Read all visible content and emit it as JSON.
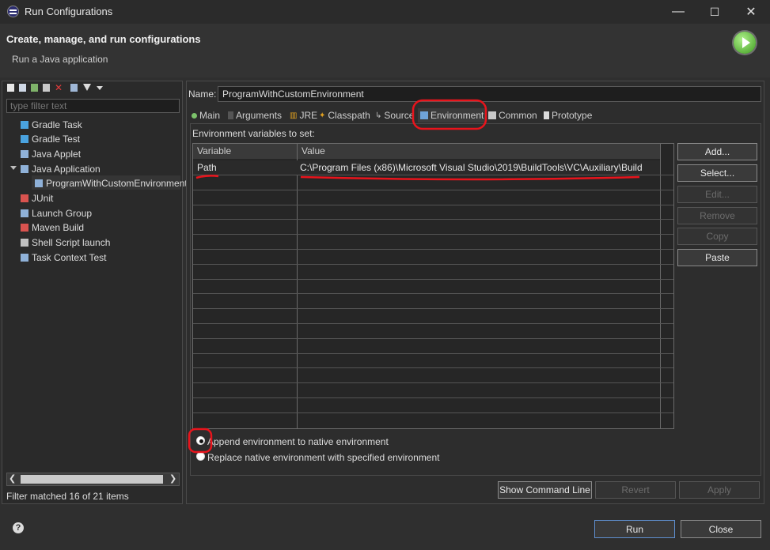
{
  "window": {
    "title": "Run Configurations",
    "minimize": "—",
    "maximize": "☐",
    "close": "✕"
  },
  "header": {
    "title": "Create, manage, and run configurations",
    "subtitle": "Run a Java application"
  },
  "left": {
    "filter_placeholder": "type filter text",
    "tree": [
      {
        "label": "Gradle Task",
        "icon": "gradle-icon",
        "color": "#4aa3df"
      },
      {
        "label": "Gradle Test",
        "icon": "gradle-icon",
        "color": "#4aa3df"
      },
      {
        "label": "Java Applet",
        "icon": "applet-icon",
        "color": "#8fb1d8"
      },
      {
        "label": "Java Application",
        "icon": "java-app-icon",
        "color": "#8fb1d8"
      },
      {
        "label": "ProgramWithCustomEnvironment",
        "icon": "java-app-icon",
        "color": "#8fb1d8"
      },
      {
        "label": "JUnit",
        "icon": "junit-icon",
        "color": "#d9534f"
      },
      {
        "label": "Launch Group",
        "icon": "launch-group-icon",
        "color": "#8fb1d8"
      },
      {
        "label": "Maven Build",
        "icon": "maven-icon",
        "color": "#d9534f"
      },
      {
        "label": "Shell Script launch",
        "icon": "shell-icon",
        "color": "#c0c0c0"
      },
      {
        "label": "Task Context Test",
        "icon": "task-icon",
        "color": "#8fb1d8"
      }
    ],
    "status": "Filter matched 16 of 21 items"
  },
  "right": {
    "name_label": "Name:",
    "name_value": "ProgramWithCustomEnvironment",
    "tabs": [
      "Main",
      "Arguments",
      "JRE",
      "Classpath",
      "Source",
      "Environment",
      "Common",
      "Prototype"
    ],
    "env_label": "Environment variables to set:",
    "table": {
      "headers": [
        "Variable",
        "Value"
      ],
      "rows": [
        {
          "variable": "Path",
          "value": "C:\\Program Files (x86)\\Microsoft Visual Studio\\2019\\BuildTools\\VC\\Auxiliary\\Build"
        }
      ]
    },
    "side_buttons": [
      "Add...",
      "Select...",
      "Edit...",
      "Remove",
      "Copy",
      "Paste"
    ],
    "radio_append": "Append environment to native environment",
    "radio_replace": "Replace native environment with specified environment",
    "show_command_line": "Show Command Line",
    "revert": "Revert",
    "apply": "Apply"
  },
  "footer": {
    "run": "Run",
    "close": "Close",
    "help": "?"
  },
  "colors": {
    "annotation": "#e8141c",
    "accent_button": "#5f8fcf"
  }
}
